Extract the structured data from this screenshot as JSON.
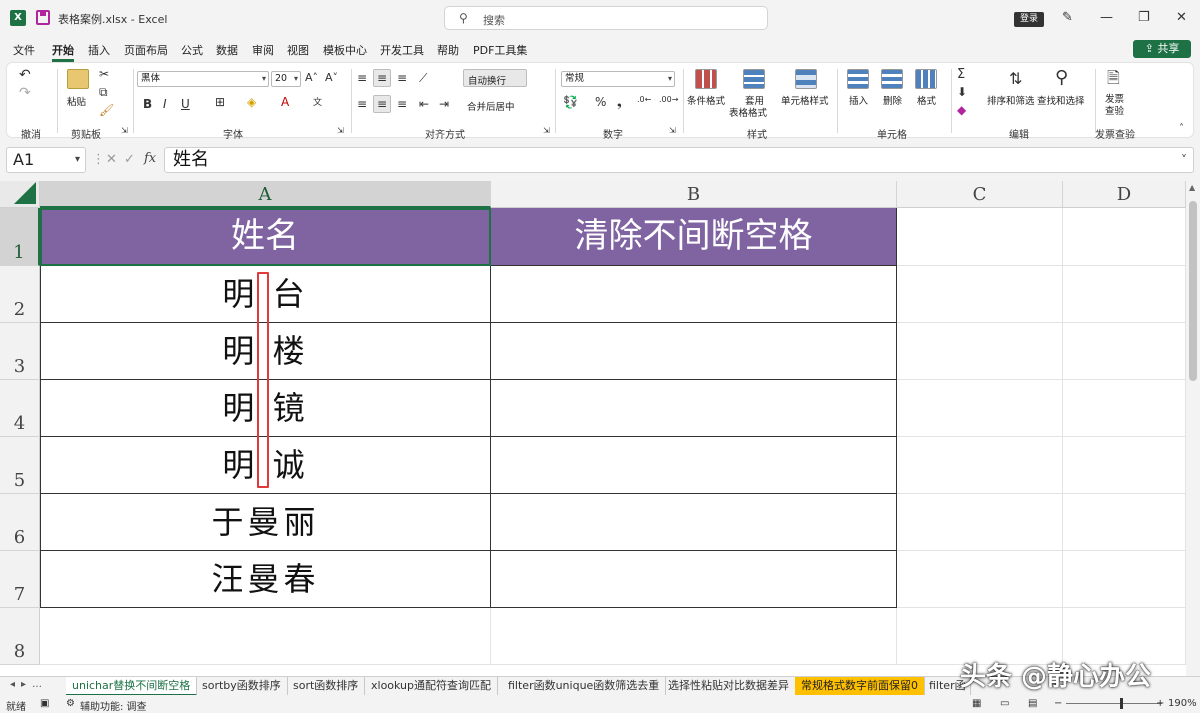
{
  "window": {
    "file_title": "表格案例.xlsx  -  Excel",
    "search_placeholder": "搜索",
    "login_label": "登录",
    "share_label": "共享"
  },
  "menu": {
    "tabs": [
      "文件",
      "开始",
      "插入",
      "页面布局",
      "公式",
      "数据",
      "审阅",
      "视图",
      "模板中心",
      "开发工具",
      "帮助",
      "PDF工具集"
    ],
    "active": "开始"
  },
  "ribbon": {
    "groups": {
      "undo": "撤消",
      "clipboard": "剪贴板",
      "font": "字体",
      "alignment": "对齐方式",
      "number": "数字",
      "styles": "样式",
      "cells": "单元格",
      "editing": "编辑",
      "invoice": "发票查验"
    },
    "paste_label": "粘贴",
    "font_name": "黑体",
    "font_size": "20",
    "bold": "B",
    "italic": "I",
    "underline": "U",
    "wrap_text": "自动换行",
    "merge_center": "合并后居中",
    "number_format": "常规",
    "percent": "%",
    "comma": "❟",
    "conditional_format": "条件格式",
    "table_format_1": "套用",
    "table_format_2": "表格格式",
    "cell_styles": "单元格样式",
    "insert": "插入",
    "delete": "删除",
    "format": "格式",
    "sort_filter": "排序和筛选",
    "find_select": "查找和选择",
    "invoice_btn_1": "发票",
    "invoice_btn_2": "查验"
  },
  "formula_bar": {
    "name_box": "A1",
    "fx": "fx",
    "content": "姓名"
  },
  "grid": {
    "columns": [
      "A",
      "B",
      "C",
      "D"
    ],
    "rows": [
      "1",
      "2",
      "3",
      "4",
      "5",
      "6",
      "7",
      "8"
    ],
    "header": {
      "a1": "姓名",
      "b1": "清除不间断空格"
    },
    "names": [
      "明 台",
      "明 楼",
      "明 镜",
      "明 诚",
      "于曼丽",
      "汪曼春"
    ]
  },
  "sheets": {
    "tabs": [
      "unichar替换不间断空格",
      "sortby函数排序",
      "sort函数排序",
      "xlookup通配符查询匹配",
      "filter函数unique函数筛选去重",
      "选择性粘贴对比数据差异",
      "常规格式数字前面保留0",
      "filter函"
    ],
    "active": "unichar替换不间断空格"
  },
  "status": {
    "ready": "就绪",
    "accessibility": "辅助功能: 调查",
    "zoom": "190%"
  },
  "watermark": "头条 @静心办公",
  "colors": {
    "accent": "#1e7145",
    "header_fill": "#8064a2",
    "highlight": "#e0393e",
    "tab_orange": "#ffc000"
  }
}
